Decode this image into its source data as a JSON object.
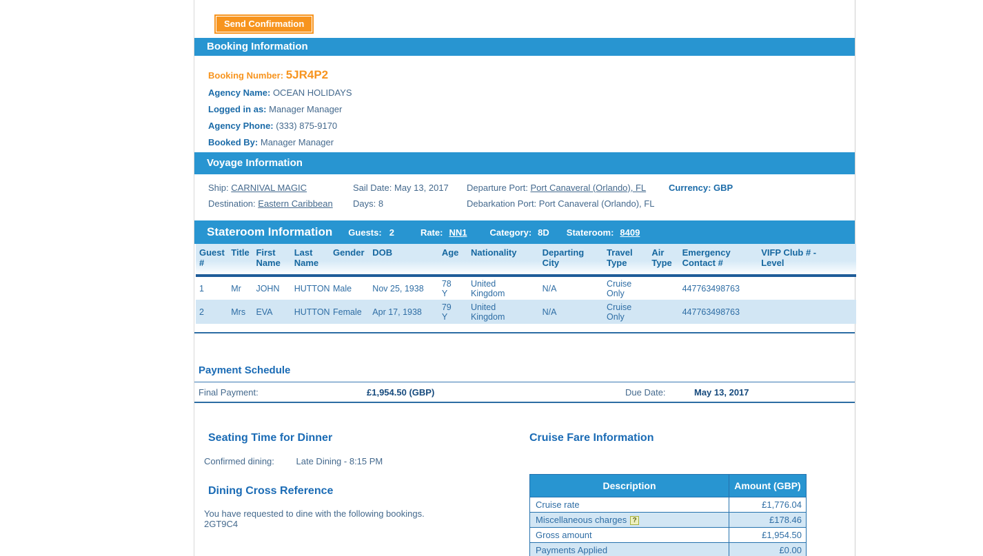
{
  "colors": {
    "bar_blue": "#2895d1",
    "accent_orange": "#f7941e",
    "label_blue": "#1b6ba8",
    "value_slate": "#44698d",
    "heading_blue": "#1a6bb5",
    "alt_row_blue": "#d2e6f4",
    "amount_navy": "#164a7d"
  },
  "toolbar": {
    "send_confirmation_label": "Send Confirmation"
  },
  "booking": {
    "section_title": "Booking Information",
    "fields": [
      {
        "label": "Booking Number:",
        "value": "5JR4P2"
      },
      {
        "label": "Agency Name:",
        "value": "OCEAN HOLIDAYS"
      },
      {
        "label": "Logged in as:",
        "value": "Manager Manager"
      },
      {
        "label": "Agency Phone:",
        "value": "(333) 875-9170"
      },
      {
        "label": "Booked By:",
        "value": "Manager Manager"
      }
    ]
  },
  "voyage": {
    "section_title": "Voyage Information",
    "ship_label": "Ship:",
    "ship": "CARNIVAL MAGIC",
    "destination_label": "Destination:",
    "destination": "Eastern Caribbean",
    "sail_date_label": "Sail Date:",
    "sail_date": "May 13, 2017",
    "days_label": "Days:",
    "days": "8",
    "departure_label": "Departure Port:",
    "departure_port": "Port Canaveral (Orlando), FL",
    "debarkation_label": "Debarkation Port:",
    "debarkation_port": "Port Canaveral (Orlando), FL",
    "currency_label": "Currency:",
    "currency": "GBP"
  },
  "stateroom": {
    "section_title": "Stateroom Information",
    "guests_label": "Guests:",
    "guests": "2",
    "rate_label": "Rate:",
    "rate": "NN1",
    "category_label": "Category:",
    "category": "8D",
    "stateroom_label": "Stateroom:",
    "stateroom_number": "8409",
    "table": {
      "headers": [
        "Guest #",
        "Title",
        "First Name",
        "Last Name",
        "Gender",
        "DOB",
        "Age",
        "Nationality",
        "Departing City",
        "Travel Type",
        "Air Type",
        "Emergency Contact #",
        "VIFP Club # - Level"
      ],
      "rows": [
        [
          "1",
          "Mr",
          "JOHN",
          "HUTTON",
          "Male",
          "Nov 25, 1938",
          "78 Y",
          "United Kingdom",
          "N/A",
          "Cruise Only",
          "",
          "447763498763",
          ""
        ],
        [
          "2",
          "Mrs",
          "EVA",
          "HUTTON",
          "Female",
          "Apr 17, 1938",
          "79 Y",
          "United Kingdom",
          "N/A",
          "Cruise Only",
          "",
          "447763498763",
          ""
        ]
      ]
    }
  },
  "payment_schedule": {
    "title": "Payment Schedule",
    "final_payment_label": "Final Payment:",
    "final_payment_value": "£1,954.50 (GBP)",
    "due_date_label": "Due Date:",
    "due_date_value": "May 13, 2017"
  },
  "dining": {
    "seating_title": "Seating Time for Dinner",
    "confirmed_label": "Confirmed dining:",
    "confirmed_value": "Late Dining - 8:15 PM",
    "cross_ref_title": "Dining Cross Reference",
    "cross_ref_text": "You have requested to dine with the following bookings.",
    "cross_ref_booking": "2GT9C4"
  },
  "fare": {
    "title": "Cruise Fare Information",
    "help_icon_glyph": "?",
    "headers": [
      "Description",
      "Amount (GBP)"
    ],
    "rows": [
      {
        "description": "Cruise rate",
        "amount": "£1,776.04"
      },
      {
        "description": "Miscellaneous charges",
        "amount": "£178.46"
      },
      {
        "description": "Gross amount",
        "amount": "£1,954.50"
      },
      {
        "description": "Payments Applied",
        "amount": "£0.00"
      }
    ]
  }
}
